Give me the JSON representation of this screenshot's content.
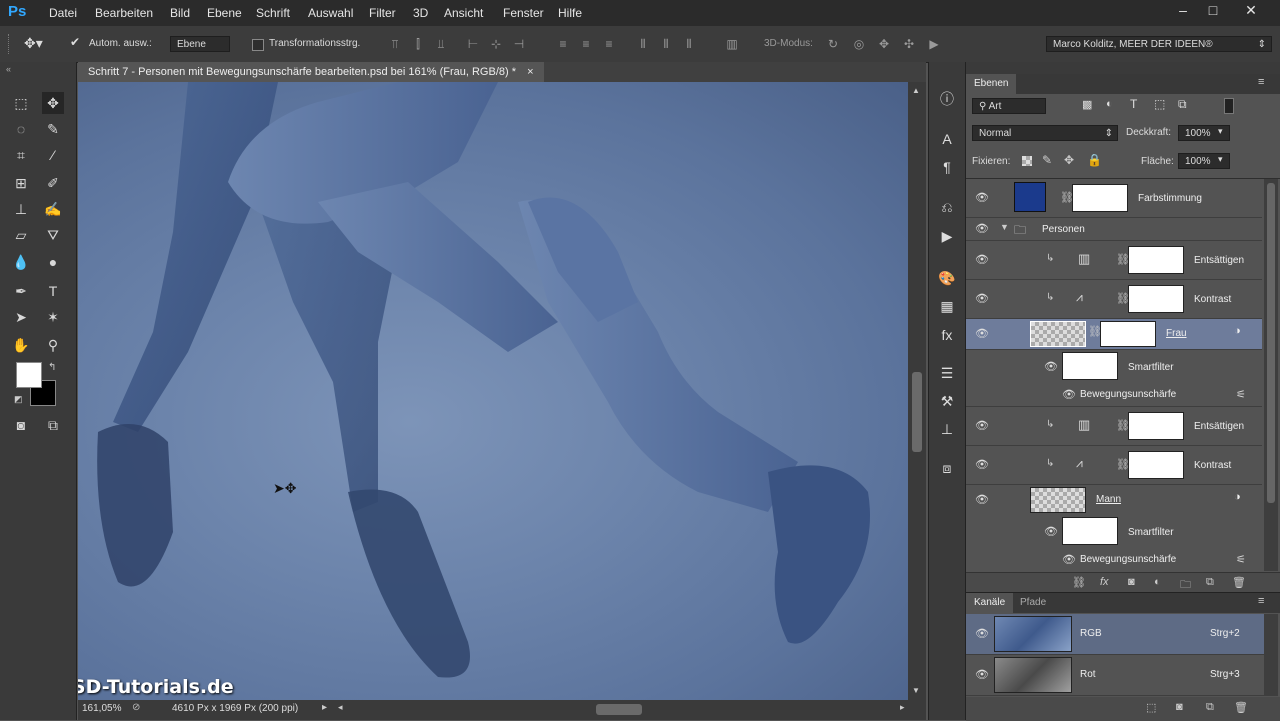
{
  "app": {
    "logo": "Ps"
  },
  "menu": [
    "Datei",
    "Bearbeiten",
    "Bild",
    "Ebene",
    "Schrift",
    "Auswahl",
    "Filter",
    "3D",
    "Ansicht",
    "Fenster",
    "Hilfe"
  ],
  "options": {
    "auto_select_label": "Autom. ausw.:",
    "auto_select_value": "Ebene",
    "transform_label": "Transformationsstrg.",
    "mode3d_label": "3D-Modus:",
    "workspace": "Marco Kolditz, MEER DER IDEEN®"
  },
  "document": {
    "tab_title": "Schritt 7 - Personen mit Bewegungsunschärfe bearbeiten.psd bei 161% (Frau, RGB/8) *",
    "close_glyph": "×",
    "watermark": "PSD-Tutorials.de"
  },
  "status": {
    "zoom": "161,05%",
    "doc_info": "4610 Px x 1969 Px (200 ppi)"
  },
  "layers_panel": {
    "tab": "Ebenen",
    "filter_kind": "Art",
    "blend_mode": "Normal",
    "opacity_label": "Deckkraft:",
    "opacity_value": "100%",
    "lock_label": "Fixieren:",
    "fill_label": "Fläche:",
    "fill_value": "100%",
    "layers": [
      {
        "name": "Farbstimmung"
      },
      {
        "name": "Personen"
      },
      {
        "name": "Entsättigen"
      },
      {
        "name": "Kontrast"
      },
      {
        "name": "Frau"
      },
      {
        "name": "Smartfilter"
      },
      {
        "name": "Bewegungsunschärfe"
      },
      {
        "name": "Entsättigen"
      },
      {
        "name": "Kontrast"
      },
      {
        "name": "Mann"
      },
      {
        "name": "Smartfilter"
      },
      {
        "name": "Bewegungsunschärfe"
      }
    ]
  },
  "channels_panel": {
    "tabs": [
      "Kanäle",
      "Pfade"
    ],
    "channels": [
      {
        "name": "RGB",
        "shortcut": "Strg+2"
      },
      {
        "name": "Rot",
        "shortcut": "Strg+3"
      }
    ]
  },
  "colors": {
    "accent_blue": "#31a8ff",
    "fill_layer": "#1b3a8c",
    "selected_row": "#6e7c9b"
  }
}
